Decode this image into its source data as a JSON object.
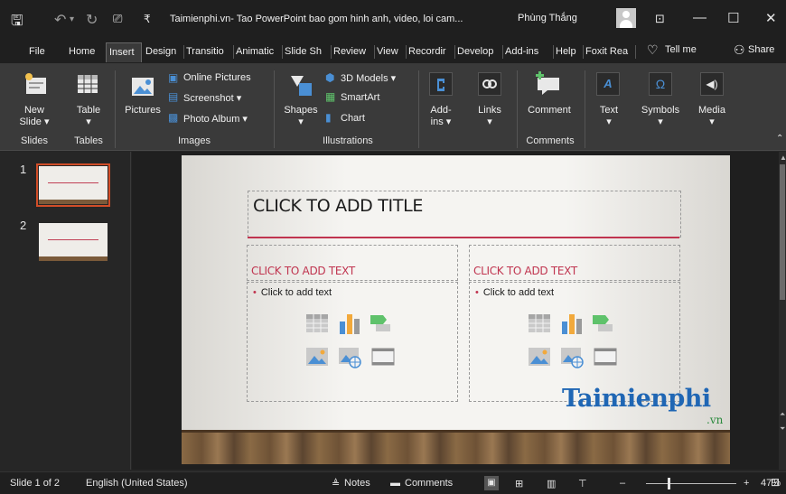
{
  "window": {
    "title": "Taimienphi.vn- Tao PowerPoint bao gom hinh anh, video, loi cam...",
    "user": "Phùng Thắng"
  },
  "tabs": [
    {
      "label": "File"
    },
    {
      "label": "Home"
    },
    {
      "label": "Insert",
      "active": true
    },
    {
      "label": "Design"
    },
    {
      "label": "Transitio"
    },
    {
      "label": "Animatic"
    },
    {
      "label": "Slide Sh"
    },
    {
      "label": "Review"
    },
    {
      "label": "View"
    },
    {
      "label": "Recordir"
    },
    {
      "label": "Develop"
    },
    {
      "label": "Add-ins"
    },
    {
      "label": "Help"
    },
    {
      "label": "Foxit Rea"
    }
  ],
  "tellme": "Tell me",
  "share": "Share",
  "ribbon": {
    "new_slide": "New",
    "new_slide2": "Slide ▾",
    "table": "Table",
    "table_arrow": "▾",
    "pictures": "Pictures",
    "online_pictures": "Online Pictures",
    "screenshot": "Screenshot ▾",
    "photo_album": "Photo Album  ▾",
    "shapes": "Shapes",
    "shapes_arrow": "▾",
    "models_3d": "3D Models  ▾",
    "smartart": "SmartArt",
    "chart": "Chart",
    "addins": "Add-",
    "addins2": "ins ▾",
    "links": "Links",
    "links_arrow": "▾",
    "comment": "Comment",
    "text": "Text",
    "text_arrow": "▾",
    "symbols": "Symbols",
    "symbols_arrow": "▾",
    "media": "Media",
    "media_arrow": "▾",
    "groups": {
      "slides": "Slides",
      "tables": "Tables",
      "images": "Images",
      "illustrations": "Illustrations",
      "comments": "Comments"
    }
  },
  "thumbs": [
    {
      "num": "1"
    },
    {
      "num": "2"
    }
  ],
  "slide": {
    "title": "CLICK TO ADD TITLE",
    "left_heading": "CLICK TO ADD TEXT",
    "left_bullet": "Click to add text",
    "right_heading": "CLICK TO ADD TEXT",
    "right_bullet": "Click to add text",
    "bullet_mark": "•"
  },
  "logo": {
    "text": "Taimienphi",
    "suffix": ".vn"
  },
  "status": {
    "slide_of": "Slide 1 of 2",
    "language": "English (United States)",
    "notes": "Notes",
    "comments": "Comments",
    "zoom": "47%"
  },
  "colors": {
    "accent": "#c0344f",
    "selection": "#d14d28",
    "logo_blue": "#1f66b4",
    "logo_green": "#2b8a3e"
  }
}
